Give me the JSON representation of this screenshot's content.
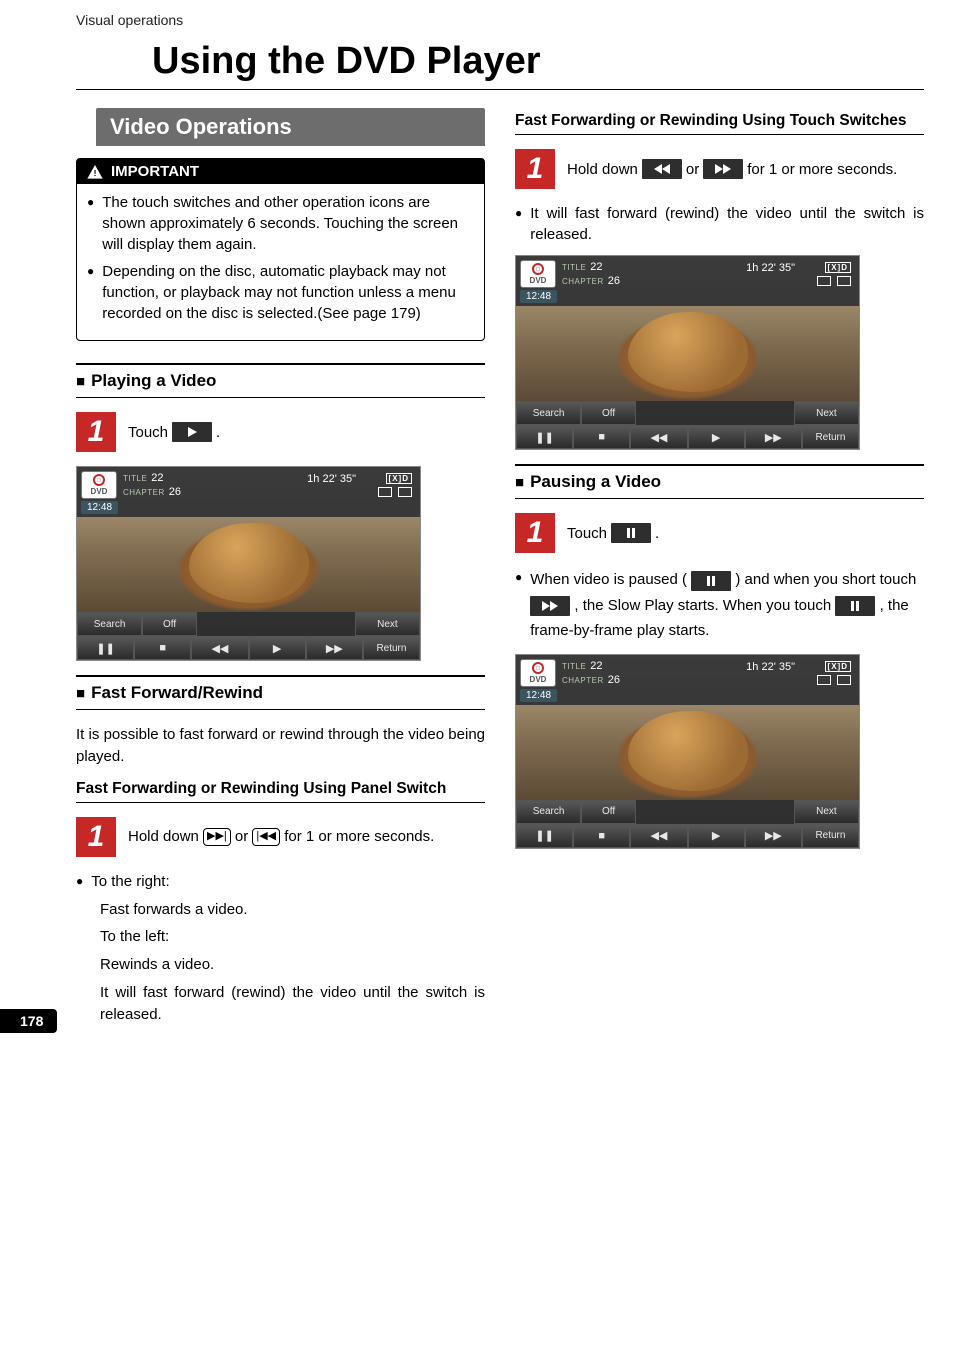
{
  "breadcrumb": "Visual operations",
  "page_title": "Using the DVD Player",
  "page_number": "178",
  "section_banner": "Video Operations",
  "important": {
    "heading": "IMPORTANT",
    "items": [
      "The touch switches and other operation icons are shown approximately 6 seconds. Touching the screen will display them again.",
      "Depending on the disc, automatic playback may not function, or playback may not function unless a menu recorded on the disc is selected.(See page 179)"
    ]
  },
  "left": {
    "playing_heading": "Playing a Video",
    "step1_prefix": "Touch ",
    "step1_suffix": ".",
    "ff_heading": "Fast Forward/Rewind",
    "ff_intro": "It is possible to fast forward or rewind through the video being played.",
    "ff_panel_heading": "Fast Forwarding or Rewinding Using Panel Switch",
    "ff_panel_step_prefix": "Hold down ",
    "ff_panel_step_mid": " or ",
    "ff_panel_step_suffix": " for 1 or more seconds.",
    "ff_bullet_lead": "To the right:",
    "ff_bullet_lines": [
      "Fast forwards a video.",
      "To the left:",
      "Rewinds a video.",
      "It will fast forward (rewind) the video until the switch is released."
    ]
  },
  "right": {
    "ff_touch_heading": "Fast Forwarding or Rewinding Using Touch Switches",
    "ff_touch_step_prefix": "Hold down ",
    "ff_touch_step_mid": " or ",
    "ff_touch_step_suffix": " for 1 or more seconds.",
    "ff_touch_bullet": "It will fast forward (rewind) the video until the switch is released.",
    "pause_heading": "Pausing a Video",
    "pause_step_prefix": "Touch ",
    "pause_step_suffix": ".",
    "pause_bullet_1a": "When video is paused (",
    "pause_bullet_1b": ") and when you short touch ",
    "pause_bullet_1c": ", the Slow Play starts. When you touch ",
    "pause_bullet_1d": ", the frame-by-frame play starts."
  },
  "screenshot": {
    "dvd_label": "DVD",
    "title_label": "TITLE",
    "title_val": "22",
    "chapter_label": "CHAPTER",
    "chapter_val": "26",
    "runtime": "1h 22' 35\"",
    "dolby": "[X]D",
    "clock": "12:48",
    "buttons_row1": [
      "Search",
      "Off",
      "",
      "",
      "",
      "Next"
    ],
    "buttons_row2": [
      "",
      "",
      "",
      "",
      "",
      "Return"
    ],
    "row2_icons": [
      "pause",
      "stop",
      "rewind",
      "play",
      "ffwd",
      ""
    ]
  }
}
